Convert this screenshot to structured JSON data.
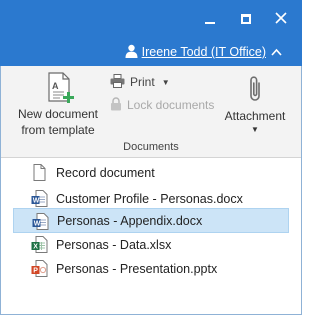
{
  "window": {
    "minimize_icon": "minimize-icon",
    "maximize_icon": "maximize-icon",
    "close_icon": "close-icon",
    "titlebar_color": "#2b79cf"
  },
  "user": {
    "name": "Ireene Todd (IT Office)",
    "icon": "user-icon",
    "collapse_icon": "chevron-up-icon"
  },
  "ribbon": {
    "new_document_label": "New document from template",
    "new_document_line1": "New document",
    "new_document_line2": "from template",
    "print_label": "Print",
    "lock_label": "Lock documents",
    "attachment_label": "Attachment",
    "group_label": "Documents",
    "disabled_color": "#a9a9a9"
  },
  "documents": [
    {
      "label": "Record document",
      "icon": "blank-document-icon",
      "selected": false
    },
    {
      "label": "Customer Profile - Personas.docx",
      "icon": "word-document-icon",
      "selected": false
    },
    {
      "label": "Personas - Appendix.docx",
      "icon": "word-document-icon",
      "selected": true
    },
    {
      "label": "Personas - Data.xlsx",
      "icon": "excel-document-icon",
      "selected": false
    },
    {
      "label": "Personas  - Presentation.pptx",
      "icon": "powerpoint-document-icon",
      "selected": false
    }
  ],
  "colors": {
    "selection_bg": "#cce4f7",
    "word": "#2b5797",
    "excel": "#1e7145",
    "powerpoint": "#d24726"
  }
}
